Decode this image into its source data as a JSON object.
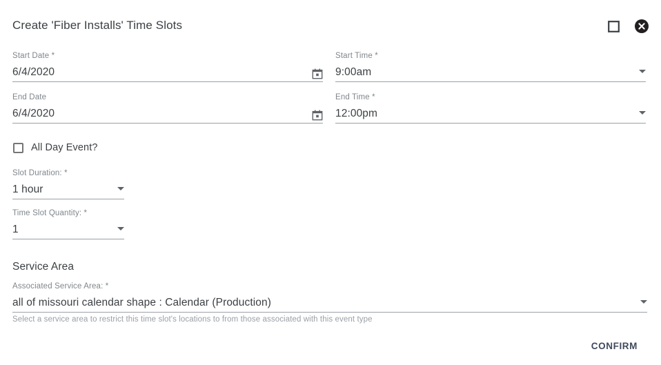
{
  "dialog": {
    "title": "Create 'Fiber Installs' Time Slots",
    "maximize_icon": "square-icon",
    "close_icon": "close-circle-icon"
  },
  "fields": {
    "start_date": {
      "label": "Start Date *",
      "value": "6/4/2020",
      "adornment": "calendar-icon"
    },
    "end_date": {
      "label": "End Date",
      "value": "6/4/2020",
      "adornment": "calendar-icon"
    },
    "start_time": {
      "label": "Start Time *",
      "value": "9:00am",
      "adornment": "chevron-down-icon"
    },
    "end_time": {
      "label": "End Time *",
      "value": "12:00pm",
      "adornment": "chevron-down-icon"
    },
    "slot_duration": {
      "label": "Slot Duration: *",
      "value": "1 hour",
      "adornment": "chevron-down-icon"
    },
    "time_slot_quantity": {
      "label": "Time Slot Quantity: *",
      "value": "1",
      "adornment": "chevron-down-icon"
    },
    "associated_service_area": {
      "label": "Associated Service Area: *",
      "value": "all of missouri calendar shape : Calendar (Production)",
      "adornment": "chevron-down-icon"
    }
  },
  "all_day_event": {
    "label": "All Day Event?",
    "checked": false
  },
  "service_area_section": {
    "heading": "Service Area",
    "hint": "Select a service area to restrict this time slot's locations to from those associated with this event type"
  },
  "footer": {
    "confirm_label": "CONFIRM"
  },
  "colors": {
    "background": "#ffffff",
    "text_primary": "#3c4043",
    "text_label": "#80868b",
    "text_hint": "#9aa0a6",
    "underline": "#9aa0a6",
    "confirm_text": "#3f4a5c",
    "close_icon": "#231f20"
  }
}
